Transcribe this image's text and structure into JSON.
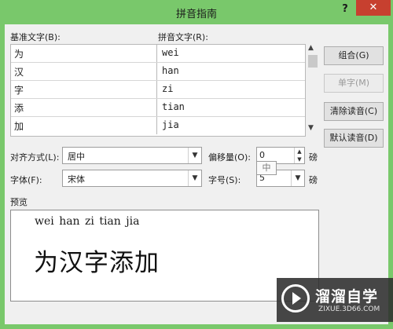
{
  "window": {
    "title": "拼音指南",
    "help_label": "?",
    "close_label": "✕"
  },
  "labels": {
    "base_text": "基准文字(B):",
    "pinyin_text": "拼音文字(R):",
    "alignment": "对齐方式(L):",
    "offset": "偏移量(O):",
    "offset_unit": "磅",
    "font": "字体(F):",
    "size": "字号(S):",
    "size_unit": "磅",
    "preview": "预览"
  },
  "rows": [
    {
      "base": "为",
      "pinyin": "wei"
    },
    {
      "base": "汉",
      "pinyin": "han"
    },
    {
      "base": "字",
      "pinyin": "zi"
    },
    {
      "base": "添",
      "pinyin": "tian"
    },
    {
      "base": "加",
      "pinyin": "jia"
    }
  ],
  "buttons": {
    "group": "组合(G)",
    "single": "单字(M)",
    "clear_reading": "清除读音(C)",
    "default_reading": "默认读音(D)"
  },
  "fields": {
    "alignment": "居中",
    "offset": "0",
    "font": "宋体",
    "size": "5",
    "ime_indicator": "中"
  },
  "preview": {
    "ruby": "wei han  zi tian jia",
    "base": "为汉字添加"
  },
  "watermark": {
    "name": "溜溜自学",
    "url": "ZIXUE.3D66.COM"
  },
  "icons": {
    "scroll_up": "chevron-up-icon",
    "scroll_down": "chevron-down-icon",
    "dropdown": "triangle-down-icon",
    "spin_up": "triangle-up-icon",
    "spin_down": "triangle-down-icon",
    "logo": "play-circle-icon"
  },
  "colors": {
    "title_bar": "#79c86b",
    "close_button": "#c7402f",
    "dialog_bg": "#f0f0f0"
  }
}
